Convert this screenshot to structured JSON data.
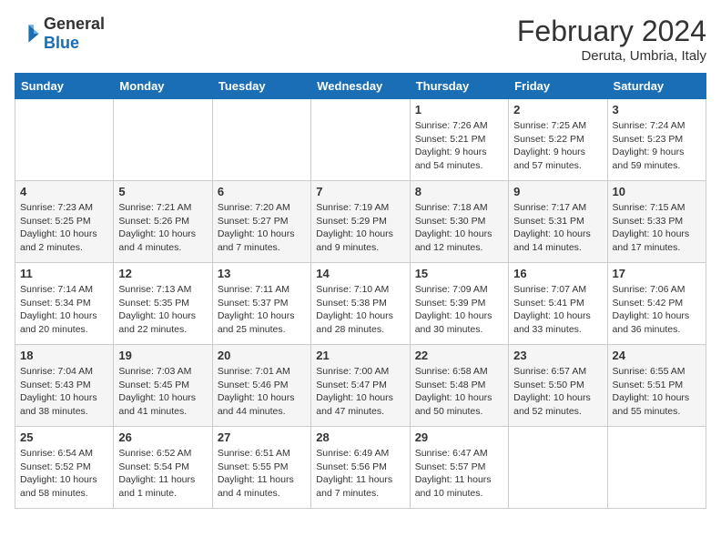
{
  "header": {
    "logo_general": "General",
    "logo_blue": "Blue",
    "title": "February 2024",
    "subtitle": "Deruta, Umbria, Italy"
  },
  "columns": [
    "Sunday",
    "Monday",
    "Tuesday",
    "Wednesday",
    "Thursday",
    "Friday",
    "Saturday"
  ],
  "weeks": [
    [
      {
        "day": "",
        "info": ""
      },
      {
        "day": "",
        "info": ""
      },
      {
        "day": "",
        "info": ""
      },
      {
        "day": "",
        "info": ""
      },
      {
        "day": "1",
        "info": "Sunrise: 7:26 AM\nSunset: 5:21 PM\nDaylight: 9 hours\nand 54 minutes."
      },
      {
        "day": "2",
        "info": "Sunrise: 7:25 AM\nSunset: 5:22 PM\nDaylight: 9 hours\nand 57 minutes."
      },
      {
        "day": "3",
        "info": "Sunrise: 7:24 AM\nSunset: 5:23 PM\nDaylight: 9 hours\nand 59 minutes."
      }
    ],
    [
      {
        "day": "4",
        "info": "Sunrise: 7:23 AM\nSunset: 5:25 PM\nDaylight: 10 hours\nand 2 minutes."
      },
      {
        "day": "5",
        "info": "Sunrise: 7:21 AM\nSunset: 5:26 PM\nDaylight: 10 hours\nand 4 minutes."
      },
      {
        "day": "6",
        "info": "Sunrise: 7:20 AM\nSunset: 5:27 PM\nDaylight: 10 hours\nand 7 minutes."
      },
      {
        "day": "7",
        "info": "Sunrise: 7:19 AM\nSunset: 5:29 PM\nDaylight: 10 hours\nand 9 minutes."
      },
      {
        "day": "8",
        "info": "Sunrise: 7:18 AM\nSunset: 5:30 PM\nDaylight: 10 hours\nand 12 minutes."
      },
      {
        "day": "9",
        "info": "Sunrise: 7:17 AM\nSunset: 5:31 PM\nDaylight: 10 hours\nand 14 minutes."
      },
      {
        "day": "10",
        "info": "Sunrise: 7:15 AM\nSunset: 5:33 PM\nDaylight: 10 hours\nand 17 minutes."
      }
    ],
    [
      {
        "day": "11",
        "info": "Sunrise: 7:14 AM\nSunset: 5:34 PM\nDaylight: 10 hours\nand 20 minutes."
      },
      {
        "day": "12",
        "info": "Sunrise: 7:13 AM\nSunset: 5:35 PM\nDaylight: 10 hours\nand 22 minutes."
      },
      {
        "day": "13",
        "info": "Sunrise: 7:11 AM\nSunset: 5:37 PM\nDaylight: 10 hours\nand 25 minutes."
      },
      {
        "day": "14",
        "info": "Sunrise: 7:10 AM\nSunset: 5:38 PM\nDaylight: 10 hours\nand 28 minutes."
      },
      {
        "day": "15",
        "info": "Sunrise: 7:09 AM\nSunset: 5:39 PM\nDaylight: 10 hours\nand 30 minutes."
      },
      {
        "day": "16",
        "info": "Sunrise: 7:07 AM\nSunset: 5:41 PM\nDaylight: 10 hours\nand 33 minutes."
      },
      {
        "day": "17",
        "info": "Sunrise: 7:06 AM\nSunset: 5:42 PM\nDaylight: 10 hours\nand 36 minutes."
      }
    ],
    [
      {
        "day": "18",
        "info": "Sunrise: 7:04 AM\nSunset: 5:43 PM\nDaylight: 10 hours\nand 38 minutes."
      },
      {
        "day": "19",
        "info": "Sunrise: 7:03 AM\nSunset: 5:45 PM\nDaylight: 10 hours\nand 41 minutes."
      },
      {
        "day": "20",
        "info": "Sunrise: 7:01 AM\nSunset: 5:46 PM\nDaylight: 10 hours\nand 44 minutes."
      },
      {
        "day": "21",
        "info": "Sunrise: 7:00 AM\nSunset: 5:47 PM\nDaylight: 10 hours\nand 47 minutes."
      },
      {
        "day": "22",
        "info": "Sunrise: 6:58 AM\nSunset: 5:48 PM\nDaylight: 10 hours\nand 50 minutes."
      },
      {
        "day": "23",
        "info": "Sunrise: 6:57 AM\nSunset: 5:50 PM\nDaylight: 10 hours\nand 52 minutes."
      },
      {
        "day": "24",
        "info": "Sunrise: 6:55 AM\nSunset: 5:51 PM\nDaylight: 10 hours\nand 55 minutes."
      }
    ],
    [
      {
        "day": "25",
        "info": "Sunrise: 6:54 AM\nSunset: 5:52 PM\nDaylight: 10 hours\nand 58 minutes."
      },
      {
        "day": "26",
        "info": "Sunrise: 6:52 AM\nSunset: 5:54 PM\nDaylight: 11 hours\nand 1 minute."
      },
      {
        "day": "27",
        "info": "Sunrise: 6:51 AM\nSunset: 5:55 PM\nDaylight: 11 hours\nand 4 minutes."
      },
      {
        "day": "28",
        "info": "Sunrise: 6:49 AM\nSunset: 5:56 PM\nDaylight: 11 hours\nand 7 minutes."
      },
      {
        "day": "29",
        "info": "Sunrise: 6:47 AM\nSunset: 5:57 PM\nDaylight: 11 hours\nand 10 minutes."
      },
      {
        "day": "",
        "info": ""
      },
      {
        "day": "",
        "info": ""
      }
    ]
  ]
}
